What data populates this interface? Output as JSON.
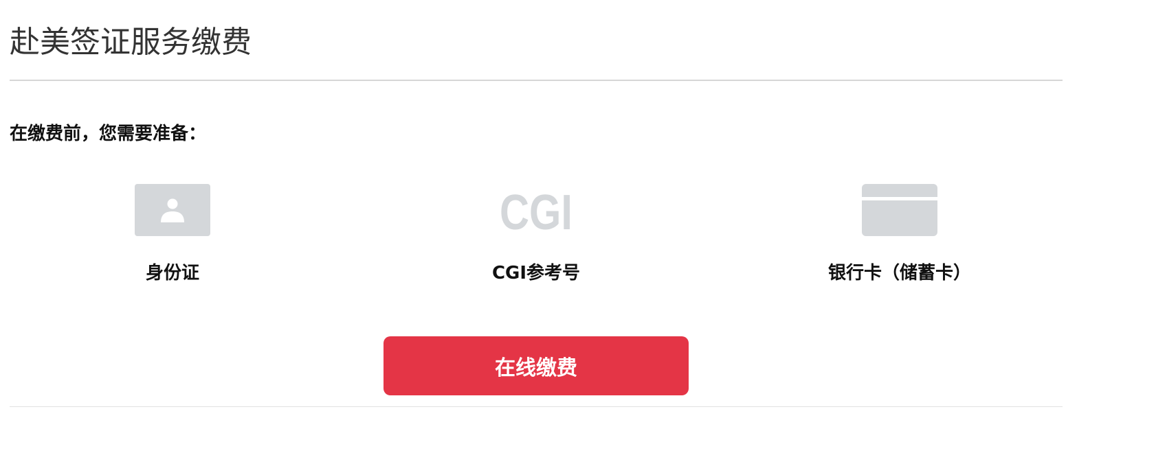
{
  "page": {
    "title": "赴美签证服务缴费"
  },
  "preparation": {
    "heading": "在缴费前，您需要准备：",
    "items": [
      {
        "icon": "id-card-icon",
        "label": "身份证"
      },
      {
        "icon": "cgi-icon",
        "icon_text": "CGI",
        "label": "CGI参考号"
      },
      {
        "icon": "bank-card-icon",
        "label": "银行卡（储蓄卡）"
      }
    ]
  },
  "actions": {
    "pay_online_label": "在线缴费"
  },
  "colors": {
    "accent": "#e43546",
    "icon_gray": "#d4d7da",
    "divider": "#d6d6d6"
  }
}
